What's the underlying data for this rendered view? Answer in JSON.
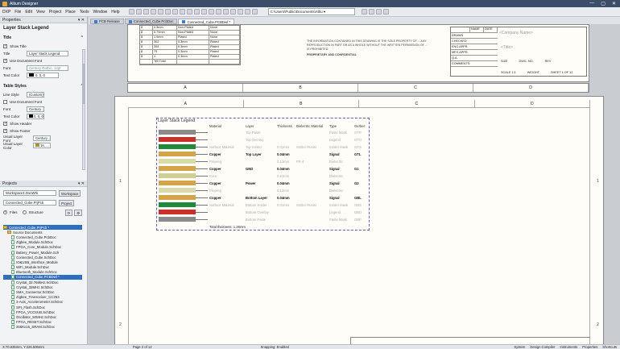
{
  "app": {
    "title": "Altium Designer",
    "window_controls": [
      "—",
      "▢",
      "✕"
    ]
  },
  "menu": [
    "DXP",
    "File",
    "Edit",
    "View",
    "Project",
    "Place",
    "Tools",
    "Window",
    "Help"
  ],
  "path": "C:\\Users\\Public\\Documents\\Altiu ▾",
  "properties": {
    "panel_title": "Properties",
    "title_section": "Layer Stack Legend",
    "title_group": "Title",
    "show_title": "Show Title",
    "title_label": "Title",
    "title_value": "Layer Stack Legend",
    "use_doc_font": "Use Document Font",
    "font_label": "Font",
    "font_value": "Century Gothic, 14pt",
    "text_color_label": "Text Color",
    "text_color_value": "0, 0, 0",
    "table_styles": "Table Styles",
    "line_style_label": "Line Style",
    "line_style_value": "(Custom)",
    "use_doc_font2": "Use Document Font",
    "font2_value": "Century ...",
    "text_color2_label": "Text Color",
    "text_color2_value": "0, 0, 0",
    "show_header": "Show Header",
    "show_footer": "Show Footer",
    "usual_font_label": "Usual Layer Font",
    "usual_font_value": "Century ...",
    "usual_color_label": "Usual Layer Color",
    "usual_color_value": "16, ..."
  },
  "projects": {
    "panel_title": "Projects",
    "workspace": "Workspace1.DsnWrk",
    "workspace_btn": "Workspace",
    "project": "Connected_Cube.PrjPcb",
    "project_btn": "Project",
    "files": "Files",
    "structure": "Structure",
    "tree": [
      {
        "label": "Connected_Cube.PrjPcb *",
        "type": "proj",
        "indent": 0,
        "sel": true
      },
      {
        "label": "Source Documents",
        "type": "folder",
        "indent": 1
      },
      {
        "label": "Connected_Cube.PcbDoc",
        "type": "doc",
        "indent": 2
      },
      {
        "label": "Zigbee_Module.SchDoc",
        "type": "doc",
        "indent": 2
      },
      {
        "label": "FPGA_Core_Module.SchDoc",
        "type": "doc",
        "indent": 2
      },
      {
        "label": "Battery_Power_Module.Sch",
        "type": "doc",
        "indent": 2
      },
      {
        "label": "Connected_Cube.SchDoc",
        "type": "doc",
        "indent": 2
      },
      {
        "label": "IO&USB_Interface_Module",
        "type": "doc",
        "indent": 2
      },
      {
        "label": "WiFi_Module.SchDoc",
        "type": "doc",
        "indent": 2
      },
      {
        "label": "Bluetooth_Module.SchDoc",
        "type": "doc",
        "indent": 2
      },
      {
        "label": "Connected_Cube.PCBDwf *",
        "type": "doc",
        "indent": 2,
        "sel": true
      },
      {
        "label": "Crystal_32.768kHz.SchDoc",
        "type": "doc",
        "indent": 2
      },
      {
        "label": "Crystal_32MHz.SchDoc",
        "type": "doc",
        "indent": 2
      },
      {
        "label": "SMA_Connector.SchDoc",
        "type": "doc",
        "indent": 2
      },
      {
        "label": "Zigbee_Transceiver_CC253",
        "type": "doc",
        "indent": 2
      },
      {
        "label": "3-Axis_Accelerometer.SchDoc",
        "type": "doc",
        "indent": 2
      },
      {
        "label": "SPI_Flash.SchDoc",
        "type": "doc",
        "indent": 2
      },
      {
        "label": "FPGA_VCCSUB.SchDoc",
        "type": "doc",
        "indent": 2
      },
      {
        "label": "Oscillator_50MHz.SchDoc",
        "type": "doc",
        "indent": 2
      },
      {
        "label": "FPGA_RESET.SchDoc",
        "type": "doc",
        "indent": 2
      },
      {
        "label": "256Kx16_SRAM.SchDoc",
        "type": "doc",
        "indent": 2
      }
    ]
  },
  "tabs": [
    {
      "label": "PCB Release",
      "active": false
    },
    {
      "label": "Connected_Cube.PcbDoc",
      "active": false
    },
    {
      "label": "Connected_Cube.PCBDwf *",
      "active": true
    }
  ],
  "zones_top": [
    "A",
    "B",
    "C",
    "D"
  ],
  "zones_mid": [
    "A",
    "B",
    "C",
    "D"
  ],
  "zones_side": [
    "1",
    "2"
  ],
  "drill_table": [
    [
      "8",
      "0.3mm",
      "Non-Plated",
      "None"
    ],
    [
      "8",
      "0.70mm",
      "Non-Plated",
      "None"
    ],
    [
      "8",
      "1.9mm",
      "Plated",
      "None"
    ],
    [
      "8",
      "302",
      "0.3mm",
      "Plated"
    ],
    [
      "8",
      "304",
      "0.3mm",
      "Plated"
    ],
    [
      "8",
      "79",
      "0.3mm",
      "Plated"
    ],
    [
      "8",
      "1",
      "0.3mm",
      "Plated"
    ],
    [
      "",
      "Tell Total",
      "",
      ""
    ]
  ],
  "title_block": {
    "note": "THE INFORMATION CONTAINED IN THIS DRAWING IS THE SOLE PROPERTY OF ... ANY REPRODUCTION IN PART OR AS A WHOLE WITHOUT THE WRITTEN PERMISSION OF ... IS PROHIBITED.",
    "proprietary": "PROPRIETARY AND CONFIDENTIAL",
    "company": "<Company Name>",
    "title": "<Title>",
    "size_label": "SIZE",
    "dwg_label": "DWG. NO.",
    "rev_label": "REV",
    "scale": "SCALE 1:1",
    "weight": "WEIGHT",
    "sheet": "SHEET 1 OF 12",
    "rows": [
      "DRAWN",
      "CHECKED",
      "ENG APPR.",
      "MFG APPR.",
      "Q.A.",
      "COMMENTS:"
    ],
    "name_date": [
      "NAME",
      "DATE"
    ]
  },
  "legend": {
    "title": "Layer Stack Legend",
    "headers": [
      "Material",
      "Layer",
      "Thickness",
      "Dielectric Material",
      "Type",
      "Gerber"
    ],
    "rows": [
      {
        "material": "",
        "layer": "Top Paste",
        "thick": "",
        "diel": "",
        "type": "Paste Mask",
        "gerber": "GTP",
        "bold": false,
        "color": "#8a8a8a"
      },
      {
        "material": "",
        "layer": "Top Overlay",
        "thick": "",
        "diel": "",
        "type": "Legend",
        "gerber": "GTO",
        "bold": false,
        "color": "#c9302c"
      },
      {
        "material": "Surface Material",
        "layer": "Top Solder",
        "thick": "0.01mm",
        "diel": "Solder Resist",
        "type": "Solder Mask",
        "gerber": "GTS",
        "bold": false,
        "color": "#1e8a3a"
      },
      {
        "material": "Copper",
        "layer": "Top Layer",
        "thick": "0.04mm",
        "diel": "",
        "type": "Signal",
        "gerber": "GTL",
        "bold": true,
        "color": "#d3a44a"
      },
      {
        "material": "Prepreg",
        "layer": "",
        "thick": "0.12mm",
        "diel": "FR-4",
        "type": "Dielectric",
        "gerber": "",
        "bold": false,
        "color": "#d9d8a8"
      },
      {
        "material": "Copper",
        "layer": "GND",
        "thick": "0.04mm",
        "diel": "",
        "type": "Signal",
        "gerber": "G1",
        "bold": true,
        "color": "#d3a44a"
      },
      {
        "material": "Core",
        "layer": "",
        "thick": "0.61mm",
        "diel": "",
        "type": "Dielectric",
        "gerber": "",
        "bold": false,
        "color": "#cfcf95"
      },
      {
        "material": "Copper",
        "layer": "Power",
        "thick": "0.04mm",
        "diel": "",
        "type": "Signal",
        "gerber": "G2",
        "bold": true,
        "color": "#d3a44a"
      },
      {
        "material": "Prepreg",
        "layer": "",
        "thick": "0.12mm",
        "diel": "",
        "type": "Dielectric",
        "gerber": "",
        "bold": false,
        "color": "#d9d8a8"
      },
      {
        "material": "Copper",
        "layer": "Bottom Layer",
        "thick": "0.04mm",
        "diel": "",
        "type": "Signal",
        "gerber": "GBL",
        "bold": true,
        "color": "#d3a44a"
      },
      {
        "material": "Surface Material",
        "layer": "Bottom Solder",
        "thick": "0.01mm",
        "diel": "Solder Resist",
        "type": "Solder Mask",
        "gerber": "GBS",
        "bold": false,
        "color": "#1e8a3a"
      },
      {
        "material": "",
        "layer": "Bottom Overlay",
        "thick": "",
        "diel": "",
        "type": "Legend",
        "gerber": "GBO",
        "bold": false,
        "color": "#c9302c"
      },
      {
        "material": "",
        "layer": "Bottom Paste",
        "thick": "",
        "diel": "",
        "type": "Paste Mask",
        "gerber": "GBP",
        "bold": false,
        "color": "#8a8a8a"
      }
    ],
    "footer": "Total thickness: 1.26mm"
  },
  "status": {
    "coords": "X:70.635mm, Y:226.506mm",
    "page": "Page 2 of 12",
    "snapping": "Snapping: Enabled",
    "right": [
      "System",
      "Design Compiler",
      "Instruments",
      "Properties",
      "Shortcuts"
    ]
  }
}
